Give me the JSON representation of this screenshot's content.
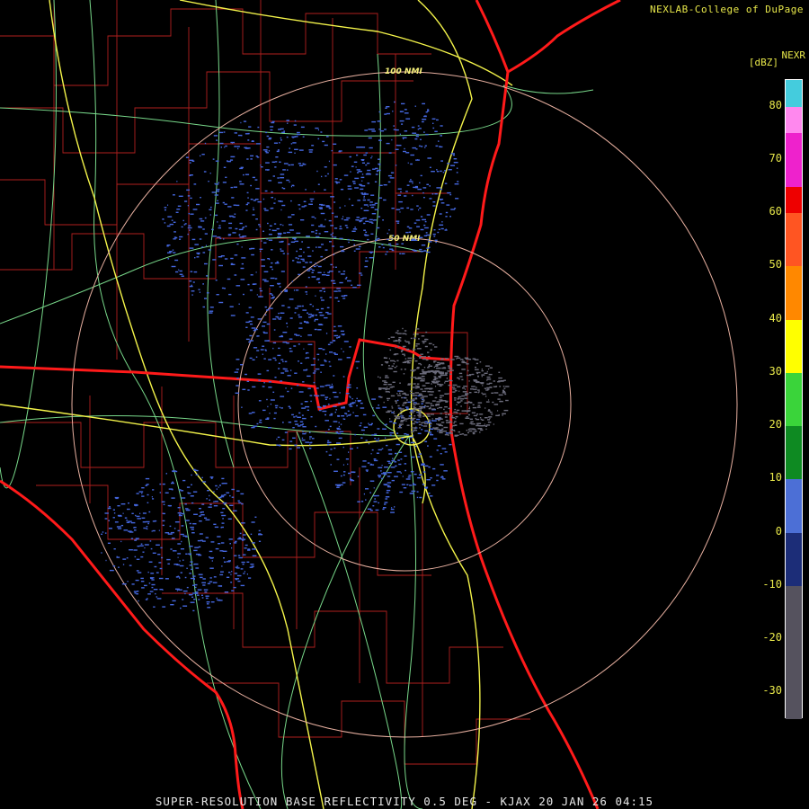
{
  "header": {
    "credit": "NEXLAB-College of DuPage",
    "product": "NEXR",
    "unit": "[dBZ]"
  },
  "range_rings": [
    "100 NMI",
    "50 NMI"
  ],
  "colorbar": {
    "ticks": [
      "80",
      "70",
      "60",
      "50",
      "40",
      "30",
      "20",
      "10",
      "0",
      "-10",
      "-20",
      "-30"
    ],
    "bands": [
      {
        "from": -35,
        "to": -10,
        "color": "#55525e"
      },
      {
        "from": -10,
        "to": 0,
        "color": "#1c2d78"
      },
      {
        "from": 0,
        "to": 10,
        "color": "#4c6fd6"
      },
      {
        "from": 10,
        "to": 20,
        "color": "#0e8a22"
      },
      {
        "from": 20,
        "to": 30,
        "color": "#3ad43a"
      },
      {
        "from": 30,
        "to": 40,
        "color": "#ffff00"
      },
      {
        "from": 40,
        "to": 50,
        "color": "#ff8800"
      },
      {
        "from": 50,
        "to": 60,
        "color": "#ff5522"
      },
      {
        "from": 60,
        "to": 65,
        "color": "#ee0000"
      },
      {
        "from": 65,
        "to": 75,
        "color": "#ee22cc"
      },
      {
        "from": 75,
        "to": 80,
        "color": "#ff88ee"
      },
      {
        "from": 80,
        "to": 85,
        "color": "#44ccdd"
      }
    ]
  },
  "colors": {
    "state_border": "#ff1a1a",
    "county_line": "#b0201e",
    "interstate": "#f4f44a",
    "highway": "#78d88a",
    "ring": "#e8b0a0",
    "echo_weak": "#4466dd",
    "echo_clutter": "#6a6a7a"
  },
  "caption": "SUPER-RESOLUTION BASE REFLECTIVITY 0.5 DEG - KJAX 20 JAN 26 04:15"
}
